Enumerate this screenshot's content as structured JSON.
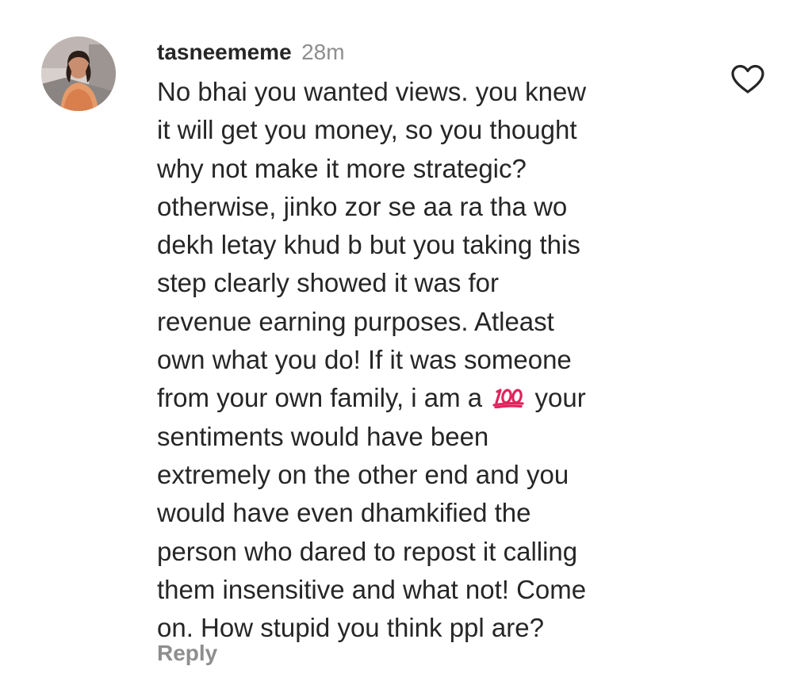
{
  "comment": {
    "username": "tasneememe",
    "timestamp": "28m",
    "avatar_icon": "profile-photo",
    "lines": [
      "No bhai you wanted views. you knew",
      "it will get you money, so you thought",
      "why not make it more strategic?",
      "otherwise, jinko zor se aa ra tha wo",
      "dekh letay khud b but you taking this",
      "step clearly showed it was for",
      "revenue earning purposes. Atleast",
      "own what you do! If it was someone",
      "from your own family, i am a",
      "sentiments would have been",
      "extremely on the other end and you",
      "would have even dhamkified the",
      "person who dared to repost it calling",
      "them insensitive and what not! Come",
      "on. How stupid you think ppl are?"
    ],
    "emoji_line_suffix": "your",
    "emoji_icon": "hundred-points-emoji",
    "reply_label": "Reply",
    "like_icon": "heart-outline-icon"
  },
  "colors": {
    "text": "#262626",
    "muted": "#8e8e8e",
    "background": "#ffffff",
    "emoji_red": "#e0245e"
  }
}
